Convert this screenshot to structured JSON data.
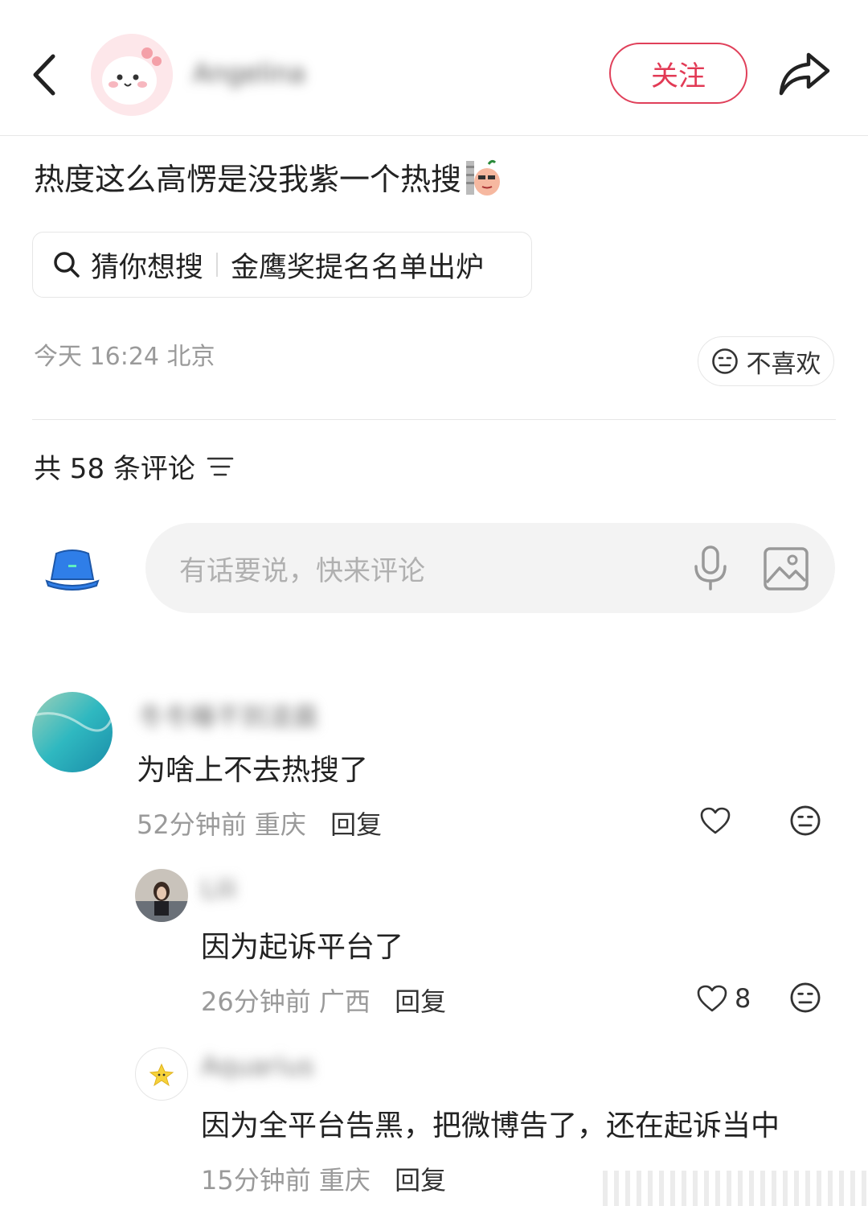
{
  "header": {
    "author_name": "Angelina",
    "follow_label": "关注"
  },
  "post": {
    "text": "热度这么高愣是没我紫一个热搜",
    "search_chip": {
      "prefix": "猜你想搜",
      "query": "金鹰奖提名名单出炉"
    },
    "time_location": "今天 16:24 北京",
    "dislike_label": "不喜欢"
  },
  "comments_header": {
    "count_label": "共 58 条评论"
  },
  "input": {
    "placeholder": "有话要说，快来评论"
  },
  "comments": [
    {
      "name": "冬冬睡不到凌晨",
      "text": "为啥上不去热搜了",
      "time": "52分钟前",
      "location": "重庆",
      "reply_label": "回复",
      "likes": ""
    },
    {
      "name": "Lili",
      "text": "因为起诉平台了",
      "time": "26分钟前",
      "location": "广西",
      "reply_label": "回复",
      "likes": "8"
    },
    {
      "name": "Aquarius",
      "text": "因为全平台告黑，把微博告了，还在起诉当中",
      "time": "15分钟前",
      "location": "重庆",
      "reply_label": "回复",
      "likes": ""
    }
  ],
  "colors": {
    "accent": "#e23a55",
    "muted_text": "#9a9a9a",
    "input_bg": "#f3f3f3"
  }
}
